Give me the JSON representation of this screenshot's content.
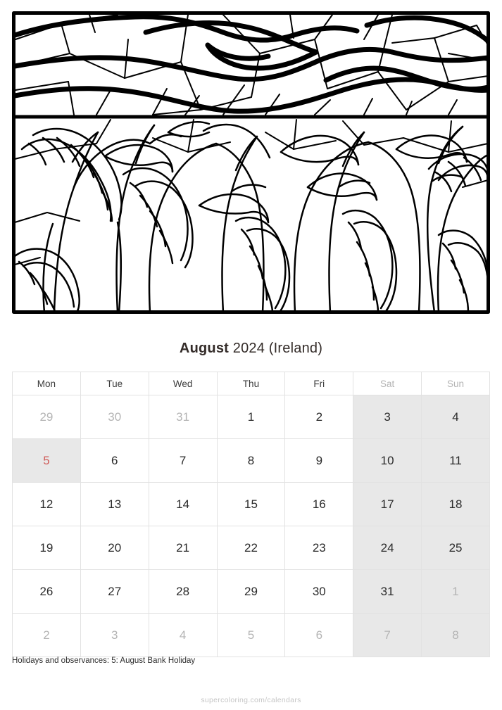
{
  "illustration": {
    "name": "stained-glass-wheat-field-coloring-page",
    "description": "Black outline stained glass style coloring picture: sky panel with flowing cloud bands above a field of wheat stalks",
    "line_color": "#000000",
    "fill_color": "#ffffff"
  },
  "title": {
    "month": "August",
    "year_region": " 2024 (Ireland)"
  },
  "calendar": {
    "weekday_headers": [
      {
        "label": "Mon",
        "weekend": false
      },
      {
        "label": "Tue",
        "weekend": false
      },
      {
        "label": "Wed",
        "weekend": false
      },
      {
        "label": "Thu",
        "weekend": false
      },
      {
        "label": "Fri",
        "weekend": false
      },
      {
        "label": "Sat",
        "weekend": true
      },
      {
        "label": "Sun",
        "weekend": true
      }
    ],
    "weeks": [
      [
        {
          "day": "29",
          "other_month": true,
          "weekend": false,
          "holiday": false
        },
        {
          "day": "30",
          "other_month": true,
          "weekend": false,
          "holiday": false
        },
        {
          "day": "31",
          "other_month": true,
          "weekend": false,
          "holiday": false
        },
        {
          "day": "1",
          "other_month": false,
          "weekend": false,
          "holiday": false
        },
        {
          "day": "2",
          "other_month": false,
          "weekend": false,
          "holiday": false
        },
        {
          "day": "3",
          "other_month": false,
          "weekend": true,
          "holiday": false
        },
        {
          "day": "4",
          "other_month": false,
          "weekend": true,
          "holiday": false
        }
      ],
      [
        {
          "day": "5",
          "other_month": false,
          "weekend": false,
          "holiday": true
        },
        {
          "day": "6",
          "other_month": false,
          "weekend": false,
          "holiday": false
        },
        {
          "day": "7",
          "other_month": false,
          "weekend": false,
          "holiday": false
        },
        {
          "day": "8",
          "other_month": false,
          "weekend": false,
          "holiday": false
        },
        {
          "day": "9",
          "other_month": false,
          "weekend": false,
          "holiday": false
        },
        {
          "day": "10",
          "other_month": false,
          "weekend": true,
          "holiday": false
        },
        {
          "day": "11",
          "other_month": false,
          "weekend": true,
          "holiday": false
        }
      ],
      [
        {
          "day": "12",
          "other_month": false,
          "weekend": false,
          "holiday": false
        },
        {
          "day": "13",
          "other_month": false,
          "weekend": false,
          "holiday": false
        },
        {
          "day": "14",
          "other_month": false,
          "weekend": false,
          "holiday": false
        },
        {
          "day": "15",
          "other_month": false,
          "weekend": false,
          "holiday": false
        },
        {
          "day": "16",
          "other_month": false,
          "weekend": false,
          "holiday": false
        },
        {
          "day": "17",
          "other_month": false,
          "weekend": true,
          "holiday": false
        },
        {
          "day": "18",
          "other_month": false,
          "weekend": true,
          "holiday": false
        }
      ],
      [
        {
          "day": "19",
          "other_month": false,
          "weekend": false,
          "holiday": false
        },
        {
          "day": "20",
          "other_month": false,
          "weekend": false,
          "holiday": false
        },
        {
          "day": "21",
          "other_month": false,
          "weekend": false,
          "holiday": false
        },
        {
          "day": "22",
          "other_month": false,
          "weekend": false,
          "holiday": false
        },
        {
          "day": "23",
          "other_month": false,
          "weekend": false,
          "holiday": false
        },
        {
          "day": "24",
          "other_month": false,
          "weekend": true,
          "holiday": false
        },
        {
          "day": "25",
          "other_month": false,
          "weekend": true,
          "holiday": false
        }
      ],
      [
        {
          "day": "26",
          "other_month": false,
          "weekend": false,
          "holiday": false
        },
        {
          "day": "27",
          "other_month": false,
          "weekend": false,
          "holiday": false
        },
        {
          "day": "28",
          "other_month": false,
          "weekend": false,
          "holiday": false
        },
        {
          "day": "29",
          "other_month": false,
          "weekend": false,
          "holiday": false
        },
        {
          "day": "30",
          "other_month": false,
          "weekend": false,
          "holiday": false
        },
        {
          "day": "31",
          "other_month": false,
          "weekend": true,
          "holiday": false
        },
        {
          "day": "1",
          "other_month": true,
          "weekend": true,
          "holiday": false
        }
      ],
      [
        {
          "day": "2",
          "other_month": true,
          "weekend": false,
          "holiday": false
        },
        {
          "day": "3",
          "other_month": true,
          "weekend": false,
          "holiday": false
        },
        {
          "day": "4",
          "other_month": true,
          "weekend": false,
          "holiday": false
        },
        {
          "day": "5",
          "other_month": true,
          "weekend": false,
          "holiday": false
        },
        {
          "day": "6",
          "other_month": true,
          "weekend": false,
          "holiday": false
        },
        {
          "day": "7",
          "other_month": true,
          "weekend": true,
          "holiday": false
        },
        {
          "day": "8",
          "other_month": true,
          "weekend": true,
          "holiday": false
        }
      ]
    ]
  },
  "footer": {
    "holidays_note": "Holidays and observances: 5: August Bank Holiday",
    "watermark": "supercoloring.com/calendars"
  },
  "colors": {
    "holiday_red": "#cf5b58",
    "weekend_shade": "#e8e8e8",
    "muted_text": "#b4b4b4",
    "title_text": "#332b28",
    "watermark_text": "#c6c6c6",
    "grid_line": "#e2e2e2"
  }
}
